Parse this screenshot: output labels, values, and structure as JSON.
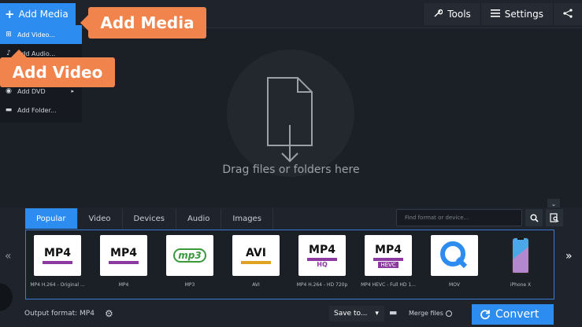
{
  "topbar": {
    "add_media_label": "Add Media",
    "tools_label": "Tools",
    "settings_label": "Settings"
  },
  "dropdown": {
    "items": [
      {
        "label": "Add Video...",
        "icon": "plus-box-icon",
        "active": true
      },
      {
        "label": "Add Audio...",
        "icon": "audio-icon",
        "active": false
      },
      {
        "label": "",
        "icon": "",
        "active": false
      },
      {
        "label": "Add DVD",
        "icon": "dvd-icon",
        "active": false,
        "submenu": true
      },
      {
        "label": "Add Folder...",
        "icon": "folder-icon",
        "active": false
      }
    ]
  },
  "callouts": {
    "media": "Add Media",
    "video": "Add Video"
  },
  "dropzone": {
    "text": "Drag files or folders here"
  },
  "tabs": [
    "Popular",
    "Video",
    "Devices",
    "Audio",
    "Images"
  ],
  "search": {
    "placeholder": "Find format or device..."
  },
  "formats": [
    {
      "badge": "MP4",
      "label": "MP4 H.264 - Original ..."
    },
    {
      "badge": "MP4",
      "label": "MP4"
    },
    {
      "badge": "mp3",
      "label": "MP3"
    },
    {
      "badge": "AVI",
      "label": "AVI"
    },
    {
      "badge": "MP4",
      "label": "MP4 H.264 - HD 720p",
      "extra": "HQ"
    },
    {
      "badge": "MP4",
      "label": "MP4 HEVC - Full HD 1...",
      "extra": "HEVC"
    },
    {
      "badge": "Q",
      "label": "MOV"
    },
    {
      "badge": "",
      "label": "iPhone X"
    }
  ],
  "footer": {
    "output_format": "Output format: MP4",
    "save_to": "Save to...",
    "merge_files": "Merge files",
    "convert": "Convert"
  },
  "colors": {
    "accent": "#2d8cf0",
    "callout": "#f0844c"
  }
}
